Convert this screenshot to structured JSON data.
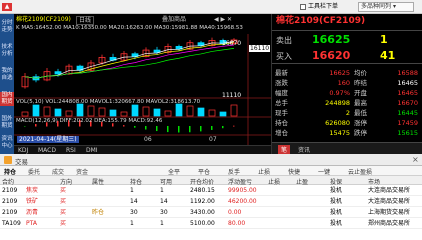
{
  "topbar": {
    "open_label": "卖出",
    "sell_label": "买入",
    "tool_label": "工具栏下单",
    "multi_label": "多品种同列"
  },
  "left_strip": [
    "分时走势",
    "技术分析",
    "我的自选",
    "国内期货",
    "国外期货",
    "资讯中心"
  ],
  "chart": {
    "title": "棉花2109(CF2109)",
    "period": "日线",
    "overlay_label": "叠加商品",
    "ma_line": "K MA5:16452.00 MA10:16350.00 MA20:16263.00 MA30:15981.88 MA40:15968.53",
    "price_labels": [
      "16670",
      "16110",
      "11110"
    ],
    "vol_line": "VOL(5,10) VOL:244808.00 MAVOL1:320667.80 MAVOL2:318613.70",
    "macd_line": "MACD(12,26,9) DIFF:202.02 DEA:155.79 MACD:92.46",
    "date_label": "2021-04-14(星期三)",
    "x_labels": [
      "06",
      "07"
    ],
    "indicator_tabs": [
      "KDJ",
      "MACD",
      "RSI",
      "DMI"
    ],
    "candles": [
      {
        "o": 15600,
        "c": 15820,
        "h": 15900,
        "l": 15560
      },
      {
        "o": 15820,
        "c": 15750,
        "h": 15880,
        "l": 15700
      },
      {
        "o": 15750,
        "c": 15930,
        "h": 16010,
        "l": 15720
      },
      {
        "o": 15930,
        "c": 15880,
        "h": 15990,
        "l": 15820
      },
      {
        "o": 15880,
        "c": 16050,
        "h": 16100,
        "l": 15860
      },
      {
        "o": 16050,
        "c": 15960,
        "h": 16080,
        "l": 15900
      },
      {
        "o": 15960,
        "c": 16120,
        "h": 16180,
        "l": 15940
      },
      {
        "o": 16120,
        "c": 16240,
        "h": 16300,
        "l": 16080
      },
      {
        "o": 16240,
        "c": 16180,
        "h": 16320,
        "l": 16150
      },
      {
        "o": 16180,
        "c": 16320,
        "h": 16380,
        "l": 16150
      },
      {
        "o": 16320,
        "c": 16260,
        "h": 16360,
        "l": 16200
      },
      {
        "o": 16260,
        "c": 16400,
        "h": 16460,
        "l": 16240
      },
      {
        "o": 16400,
        "c": 16350,
        "h": 16470,
        "l": 16300
      },
      {
        "o": 16350,
        "c": 16480,
        "h": 16540,
        "l": 16320
      },
      {
        "o": 16480,
        "c": 16420,
        "h": 16520,
        "l": 16380
      },
      {
        "o": 16420,
        "c": 16560,
        "h": 16620,
        "l": 16400
      },
      {
        "o": 16560,
        "c": 16500,
        "h": 16600,
        "l": 16460
      },
      {
        "o": 16500,
        "c": 16610,
        "h": 16670,
        "l": 16480
      },
      {
        "o": 16610,
        "c": 16540,
        "h": 16650,
        "l": 16500
      },
      {
        "o": 16540,
        "c": 16620,
        "h": 16660,
        "l": 16520
      }
    ]
  },
  "quote": {
    "title": "棉花2109(CF2109)",
    "sell_label": "卖出",
    "sell_price": "16625",
    "sell_vol": "1",
    "buy_label": "买入",
    "buy_price": "16620",
    "buy_vol": "41",
    "rows": [
      {
        "l1": "最新",
        "v1": "16625",
        "l2": "均价",
        "v2": "16588"
      },
      {
        "l1": "涨跌",
        "v1": "160",
        "l2": "昨结",
        "v2": "16465"
      },
      {
        "l1": "幅度",
        "v1": "0.97%",
        "l2": "开盘",
        "v2": "16465"
      },
      {
        "l1": "总手",
        "v1": "244898",
        "l2": "最高",
        "v2": "16670"
      },
      {
        "l1": "现手",
        "v1": "2",
        "l2": "最低",
        "v2": "16445"
      },
      {
        "l1": "持仓",
        "v1": "626080",
        "l2": "涨停",
        "v2": "17459"
      },
      {
        "l1": "增仓",
        "v1": "15475",
        "l2": "跌停",
        "v2": "15615"
      }
    ],
    "tabs": [
      "笔",
      "资讯"
    ]
  },
  "panel": {
    "title": "交易",
    "close": "×",
    "tabs": [
      "持仓",
      "委托",
      "成交",
      "资金"
    ],
    "tab_right": [
      "全平",
      "平仓",
      "反手",
      "止损",
      "快捷",
      "一键",
      "云止盈损"
    ],
    "columns": [
      "合约",
      "方向",
      "属性",
      "持仓",
      "可用",
      "开仓均价",
      "浮动盈亏",
      "止损",
      "止盈",
      "投保",
      "市场"
    ],
    "rows": [
      {
        "code": "2109",
        "name": "焦炭",
        "dir": "买",
        "attr": "",
        "hold": "1",
        "avail": "1",
        "price": "2480.15",
        "pl": "99905.00",
        "sl": "",
        "tp": "",
        "hedge": "投机",
        "market": "大连商品交易所"
      },
      {
        "code": "2109",
        "name": "铁矿",
        "dir": "买",
        "attr": "",
        "hold": "14",
        "avail": "14",
        "price": "1192.00",
        "pl": "46200.00",
        "sl": "",
        "tp": "",
        "hedge": "投机",
        "market": "大连商品交易所"
      },
      {
        "code": "2109",
        "name": "沥青",
        "dir": "买",
        "attr": "昨仓",
        "hold": "30",
        "avail": "30",
        "price": "3430.00",
        "pl": "0.00",
        "sl": "",
        "tp": "",
        "hedge": "投机",
        "market": "上海期货交易所"
      },
      {
        "code": "TA109",
        "name": "PTA",
        "dir": "买",
        "attr": "",
        "hold": "1",
        "avail": "1",
        "price": "5100.00",
        "pl": "80.00",
        "sl": "",
        "tp": "",
        "hedge": "投机",
        "market": "郑州商品交易所"
      }
    ]
  },
  "colors": {
    "up": "#ff3232",
    "down": "#00e000",
    "bg": "#000000",
    "panel_bg": "#1e4f8c"
  }
}
